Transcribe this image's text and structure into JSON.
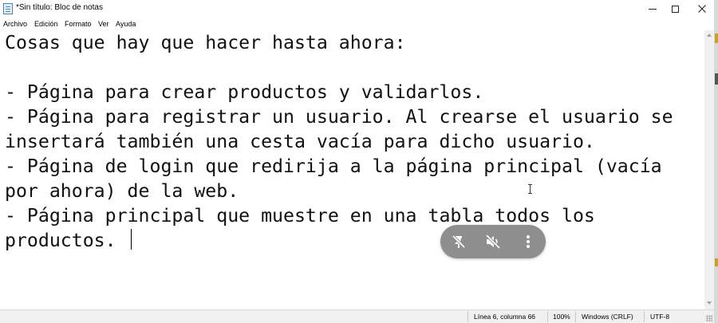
{
  "window": {
    "title": "*Sin título: Bloc de notas",
    "icon": "notepad-icon"
  },
  "menu": [
    "Archivo",
    "Edición",
    "Formato",
    "Ver",
    "Ayuda"
  ],
  "editor": {
    "lines": [
      "Cosas que hay que hacer hasta ahora:",
      "",
      "- Página para crear productos y validarlos.",
      "- Página para registrar un usuario. Al crearse el usuario se",
      "insertará también una cesta vacía para dicho usuario.",
      "- Página de login que redirija a la página principal (vacía",
      "por ahora) de la web.",
      "- Página principal que muestre en una tabla todos los",
      "productos. "
    ]
  },
  "floating_toolbar": {
    "icons": [
      "pin-off-icon",
      "mute-icon",
      "more-vertical-icon"
    ]
  },
  "status": {
    "position": "Línea 6, columna 66",
    "zoom": "100%",
    "line_ending": "Windows (CRLF)",
    "encoding": "UTF-8"
  },
  "colors": {
    "floatbar_bg": "#8e8e8e",
    "statusbar_bg": "#f0f0f0"
  }
}
